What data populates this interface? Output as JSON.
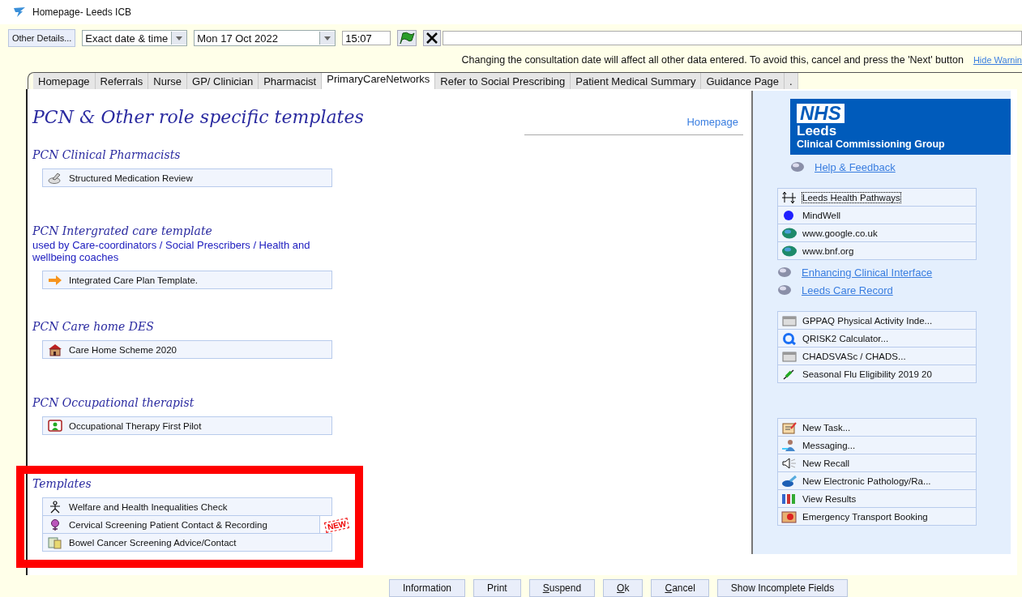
{
  "window": {
    "title": "Homepage- Leeds ICB"
  },
  "toolbar": {
    "other_details": "Other Details...",
    "date_mode": "Exact date & time",
    "date": "Mon 17 Oct 2022",
    "time": "15:07"
  },
  "warning": {
    "text": "Changing the consultation date will affect all other data entered. To avoid this, cancel and press the 'Next' button",
    "link": "Hide Warnin"
  },
  "tabs": [
    {
      "label": "Homepage",
      "selected": false
    },
    {
      "label": "Referrals",
      "selected": false
    },
    {
      "label": "Nurse",
      "selected": false
    },
    {
      "label": "GP/ Clinician",
      "selected": false
    },
    {
      "label": "Pharmacist",
      "selected": false
    },
    {
      "label": "PrimaryCareNetworks",
      "selected": true
    },
    {
      "label": "Refer to Social Prescribing",
      "selected": false
    },
    {
      "label": "Patient Medical Summary",
      "selected": false
    },
    {
      "label": "Guidance Page",
      "selected": false
    },
    {
      "label": ".",
      "selected": false
    }
  ],
  "page": {
    "title": "PCN & Other role specific templates",
    "home_link": "Homepage"
  },
  "sections": [
    {
      "title": "PCN Clinical Pharmacists",
      "items": [
        {
          "label": "Structured Medication Review"
        }
      ]
    },
    {
      "title": "PCN Intergrated care template",
      "subtitle": "used by Care-coordinators / Social Prescribers / Health and wellbeing coaches",
      "items": [
        {
          "label": "Integrated Care Plan Template."
        }
      ]
    },
    {
      "title": "PCN Care home DES",
      "items": [
        {
          "label": "Care Home Scheme 2020"
        }
      ]
    },
    {
      "title": "PCN Occupational therapist",
      "items": [
        {
          "label": "Occupational Therapy First Pilot"
        }
      ]
    },
    {
      "title": "Templates",
      "highlighted": true,
      "items": [
        {
          "label": "Welfare and Health Inequalities Check"
        },
        {
          "label": "Cervical Screening Patient Contact & Recording",
          "badge": "NEW"
        },
        {
          "label": "Bowel Cancer Screening Advice/Contact"
        }
      ]
    }
  ],
  "sidebar": {
    "logo": {
      "mark": "NHS",
      "org": "Leeds",
      "subtitle": "Clinical Commissioning Group"
    },
    "groups": [
      {
        "kind": "links",
        "items": [
          {
            "label": "Help & Feedback"
          }
        ]
      },
      {
        "kind": "list",
        "items": [
          {
            "label": "Leeds Health Pathways",
            "focused": true
          },
          {
            "label": "MindWell",
            "focused": false
          },
          {
            "label": "www.google.co.uk",
            "focused": false
          },
          {
            "label": "www.bnf.org",
            "focused": false
          }
        ]
      },
      {
        "kind": "links",
        "items": [
          {
            "label": "Enhancing Clinical Interface"
          },
          {
            "label": "Leeds Care Record"
          }
        ]
      },
      {
        "kind": "list",
        "items": [
          {
            "label": "GPPAQ Physical Activity Inde...",
            "focused": false
          },
          {
            "label": "QRISK2 Calculator...",
            "focused": false
          },
          {
            "label": "CHADSVASc / CHADS...",
            "focused": false
          },
          {
            "label": "Seasonal Flu Eligibility 2019 20",
            "focused": false
          }
        ]
      },
      {
        "kind": "list",
        "items": [
          {
            "label": "New Task...",
            "focused": false
          },
          {
            "label": "Messaging...",
            "focused": false
          },
          {
            "label": "New Recall",
            "focused": false
          },
          {
            "label": "New Electronic Pathology/Ra...",
            "focused": false
          },
          {
            "label": "View Results",
            "focused": false
          },
          {
            "label": "Emergency Transport Booking",
            "focused": false
          }
        ]
      }
    ]
  },
  "buttons": [
    {
      "label": "Information",
      "mnemonic": false
    },
    {
      "label": "Print",
      "mnemonic": false
    },
    {
      "label": "Suspend",
      "mnemonic": true
    },
    {
      "label": "Ok",
      "mnemonic": true
    },
    {
      "label": "Cancel",
      "mnemonic": true
    },
    {
      "label": "Show Incomplete Fields",
      "mnemonic": false
    }
  ]
}
